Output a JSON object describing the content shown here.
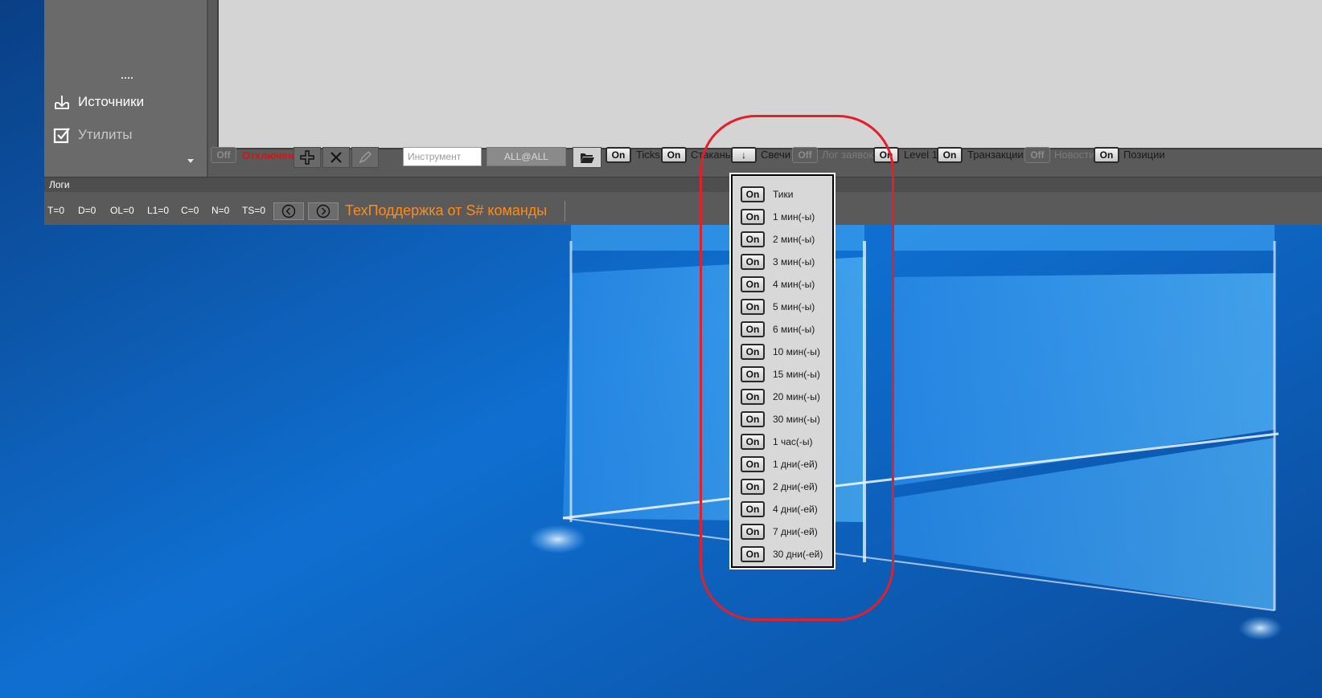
{
  "sidebar": {
    "items": [
      {
        "label": "Источники",
        "icon": "import-tray-icon"
      },
      {
        "label": "Утилиты",
        "icon": "checkbox-checked-icon"
      }
    ]
  },
  "toolbar": {
    "connect_toggle": "Off",
    "connection_status": "Отключен",
    "instrument_placeholder": "Инструмент",
    "portfolio_value": "ALL@ALL",
    "ticks_toggle": "On",
    "ticks_label": "Ticks",
    "depth_toggle": "On",
    "depth_label": "Стаканы",
    "candles_dropdown": "↓",
    "candles_label": "Свечи",
    "orderlog_toggle": "Off",
    "orderlog_label": "Лог заявок",
    "level1_toggle": "On",
    "level1_label": "Level 1",
    "transactions_toggle": "On",
    "transactions_label": "Транзакции",
    "news_toggle": "Off",
    "news_label": "Новости",
    "positions_toggle": "On",
    "positions_label": "Позиции"
  },
  "logs": {
    "title": "Логи",
    "counters": [
      "T=0",
      "D=0",
      "OL=0",
      "L1=0",
      "C=0",
      "N=0",
      "TS=0"
    ],
    "support_text": "ТехПоддержка от S# команды"
  },
  "candles_popup": {
    "items": [
      {
        "state": "On",
        "label": "Тики"
      },
      {
        "state": "On",
        "label": "1 мин(-ы)"
      },
      {
        "state": "On",
        "label": "2 мин(-ы)"
      },
      {
        "state": "On",
        "label": "3 мин(-ы)"
      },
      {
        "state": "On",
        "label": "4 мин(-ы)"
      },
      {
        "state": "On",
        "label": "5 мин(-ы)"
      },
      {
        "state": "On",
        "label": "6 мин(-ы)"
      },
      {
        "state": "On",
        "label": "10 мин(-ы)"
      },
      {
        "state": "On",
        "label": "15 мин(-ы)"
      },
      {
        "state": "On",
        "label": "20 мин(-ы)"
      },
      {
        "state": "On",
        "label": "30 мин(-ы)"
      },
      {
        "state": "On",
        "label": "1 час(-ы)"
      },
      {
        "state": "On",
        "label": "1 дни(-ей)"
      },
      {
        "state": "On",
        "label": "2 дни(-ей)"
      },
      {
        "state": "On",
        "label": "4 дни(-ей)"
      },
      {
        "state": "On",
        "label": "7 дни(-ей)"
      },
      {
        "state": "On",
        "label": "30 дни(-ей)"
      }
    ]
  },
  "colors": {
    "status_disconnected": "#e01010",
    "support_link": "#ff8c1a",
    "highlight_ring": "#e3202a"
  }
}
